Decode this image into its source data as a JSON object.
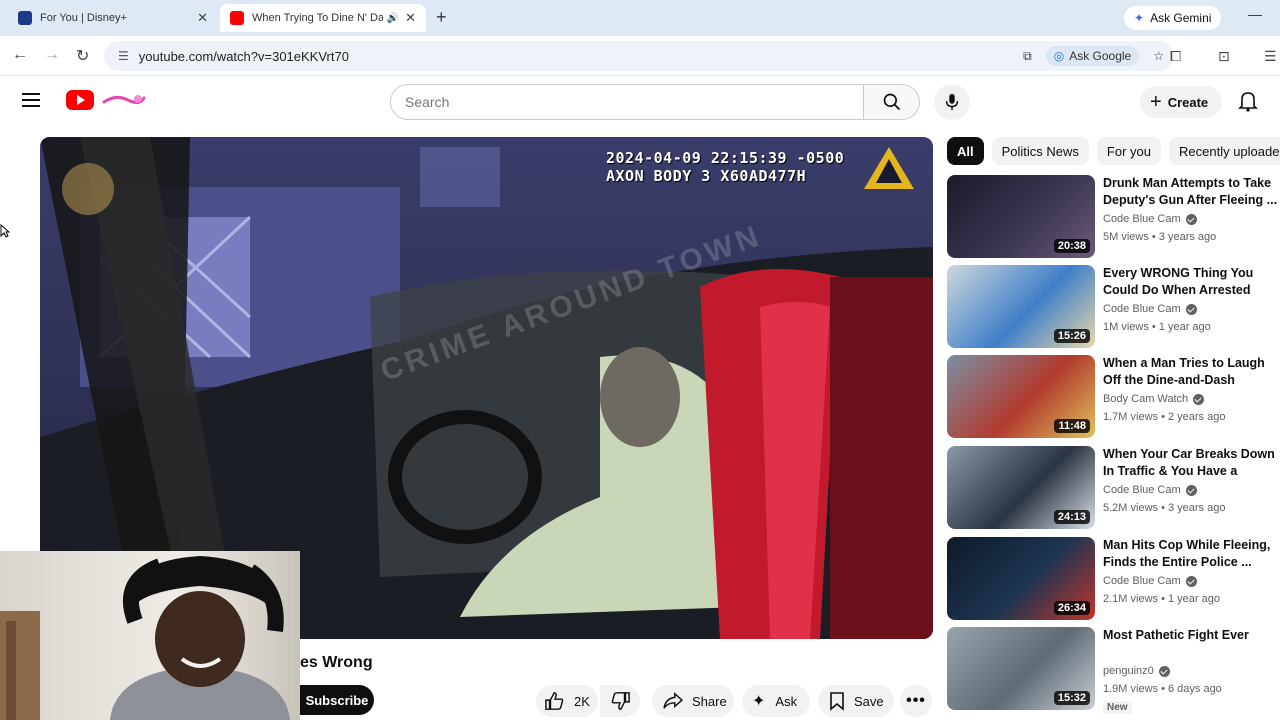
{
  "browser": {
    "tabs": [
      {
        "title": "For You | Disney+",
        "active": false
      },
      {
        "title": "When Trying To Dine N' Dash",
        "active": true
      }
    ],
    "gemini_label": "Ask Gemini",
    "url": "youtube.com/watch?v=301eKKVrt70",
    "ask_google_label": "Ask Google"
  },
  "header": {
    "search_placeholder": "Search",
    "create_label": "Create"
  },
  "player": {
    "timestamp_line1": "2024-04-09 22:15:39 -0500",
    "timestamp_line2": "AXON BODY 3 X60AD477H",
    "watermark": "CRIME AROUND TOWN"
  },
  "video": {
    "title_fragment": "es Wrong",
    "subscribe_label": "Subscribe",
    "like_count": "2K",
    "share_label": "Share",
    "ask_label": "Ask",
    "save_label": "Save"
  },
  "chips": [
    {
      "label": "All",
      "active": true
    },
    {
      "label": "Politics News",
      "active": false
    },
    {
      "label": "For you",
      "active": false
    },
    {
      "label": "Recently uploaded",
      "active": false
    }
  ],
  "recommendations": [
    {
      "title": "Drunk Man Attempts to Take Deputy's Gun After Fleeing ...",
      "channel": "Code Blue Cam",
      "verified": true,
      "meta": "5M views • 3 years ago",
      "duration": "20:38",
      "thumb_colors": [
        "#1c1a2a",
        "#3a3550",
        "#6d5a7a"
      ]
    },
    {
      "title": "Every WRONG Thing You Could Do When Arrested",
      "channel": "Code Blue Cam",
      "verified": true,
      "meta": "1M views • 1 year ago",
      "duration": "15:26",
      "thumb_colors": [
        "#cfd8dc",
        "#3f7fc9",
        "#e8d7a8"
      ]
    },
    {
      "title": "When a Man Tries to Laugh Off the Dine-and-Dash Accusations",
      "channel": "Body Cam Watch",
      "verified": true,
      "meta": "1.7M views • 2 years ago",
      "duration": "11:48",
      "thumb_colors": [
        "#7b8fa3",
        "#b23a2e",
        "#e0c35b"
      ]
    },
    {
      "title": "When Your Car Breaks Down In Traffic & You Have a Warrant",
      "channel": "Code Blue Cam",
      "verified": true,
      "meta": "5.2M views • 3 years ago",
      "duration": "24:13",
      "thumb_colors": [
        "#8a9aa8",
        "#2b3442",
        "#d9e0e6"
      ]
    },
    {
      "title": "Man Hits Cop While Fleeing, Finds the Entire Police ...",
      "channel": "Code Blue Cam",
      "verified": true,
      "meta": "2.1M views • 1 year ago",
      "duration": "26:34",
      "thumb_colors": [
        "#0e1a2a",
        "#1d3550",
        "#c2352d"
      ]
    },
    {
      "title": "Most Pathetic Fight Ever",
      "channel": "penguinz0",
      "verified": true,
      "meta": "1.9M views • 6 days ago",
      "duration": "15:32",
      "badge": "New",
      "thumb_colors": [
        "#9aa4ad",
        "#5f6b75",
        "#c8ced3"
      ]
    }
  ]
}
